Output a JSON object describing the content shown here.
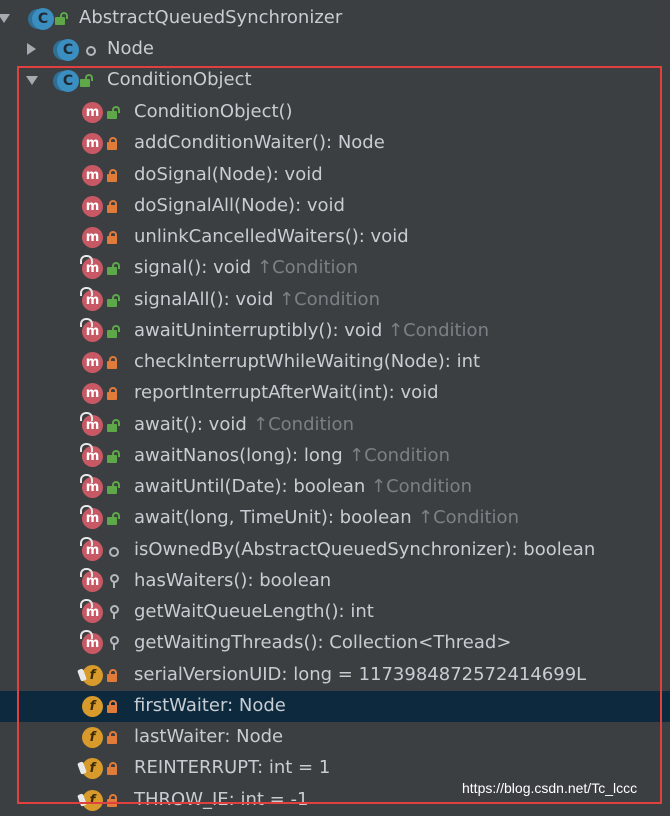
{
  "tree": {
    "root": {
      "label": "AbstractQueuedSynchronizer",
      "icon": "C"
    },
    "node": {
      "label": "Node",
      "icon": "C"
    },
    "condition_object": {
      "label": "ConditionObject",
      "icon": "C"
    },
    "members": [
      {
        "name": "ConditionObject()",
        "kind": "m",
        "access": "public",
        "inherit": ""
      },
      {
        "name": "addConditionWaiter(): Node",
        "kind": "m",
        "access": "private",
        "inherit": ""
      },
      {
        "name": "doSignal(Node): void",
        "kind": "m",
        "access": "private",
        "inherit": ""
      },
      {
        "name": "doSignalAll(Node): void",
        "kind": "m",
        "access": "private",
        "inherit": ""
      },
      {
        "name": "unlinkCancelledWaiters(): void",
        "kind": "m",
        "access": "private",
        "inherit": ""
      },
      {
        "name": "signal(): void",
        "kind": "m",
        "access": "public",
        "inherit": "↑Condition"
      },
      {
        "name": "signalAll(): void",
        "kind": "m",
        "access": "public",
        "inherit": "↑Condition"
      },
      {
        "name": "awaitUninterruptibly(): void",
        "kind": "m",
        "access": "public",
        "inherit": "↑Condition"
      },
      {
        "name": "checkInterruptWhileWaiting(Node): int",
        "kind": "m",
        "access": "private",
        "inherit": ""
      },
      {
        "name": "reportInterruptAfterWait(int): void",
        "kind": "m",
        "access": "private",
        "inherit": ""
      },
      {
        "name": "await(): void",
        "kind": "m",
        "access": "public",
        "inherit": "↑Condition"
      },
      {
        "name": "awaitNanos(long): long",
        "kind": "m",
        "access": "public",
        "inherit": "↑Condition"
      },
      {
        "name": "awaitUntil(Date): boolean",
        "kind": "m",
        "access": "public",
        "inherit": "↑Condition"
      },
      {
        "name": "await(long, TimeUnit): boolean",
        "kind": "m",
        "access": "public",
        "inherit": "↑Condition"
      },
      {
        "name": "isOwnedBy(AbstractQueuedSynchronizer): boolean",
        "kind": "m",
        "access": "package",
        "inherit": ""
      },
      {
        "name": "hasWaiters(): boolean",
        "kind": "m",
        "access": "protected",
        "inherit": ""
      },
      {
        "name": "getWaitQueueLength(): int",
        "kind": "m",
        "access": "protected",
        "inherit": ""
      },
      {
        "name": "getWaitingThreads(): Collection<Thread>",
        "kind": "m",
        "access": "protected",
        "inherit": ""
      },
      {
        "name": "serialVersionUID: long = 1173984872572414699L",
        "kind": "f",
        "access": "private",
        "inherit": ""
      },
      {
        "name": "firstWaiter: Node",
        "kind": "f",
        "access": "private",
        "inherit": ""
      },
      {
        "name": "lastWaiter: Node",
        "kind": "f",
        "access": "private",
        "inherit": ""
      },
      {
        "name": "REINTERRUPT: int = 1",
        "kind": "f",
        "access": "private",
        "inherit": ""
      },
      {
        "name": "THROW_IE: int = -1",
        "kind": "f",
        "access": "private",
        "inherit": ""
      }
    ]
  },
  "watermark": "https://blog.csdn.net/Tc_lccc",
  "colors": {
    "background": "#3c3f41",
    "selection": "#0d293e",
    "highlight_box": "#e0413e"
  }
}
